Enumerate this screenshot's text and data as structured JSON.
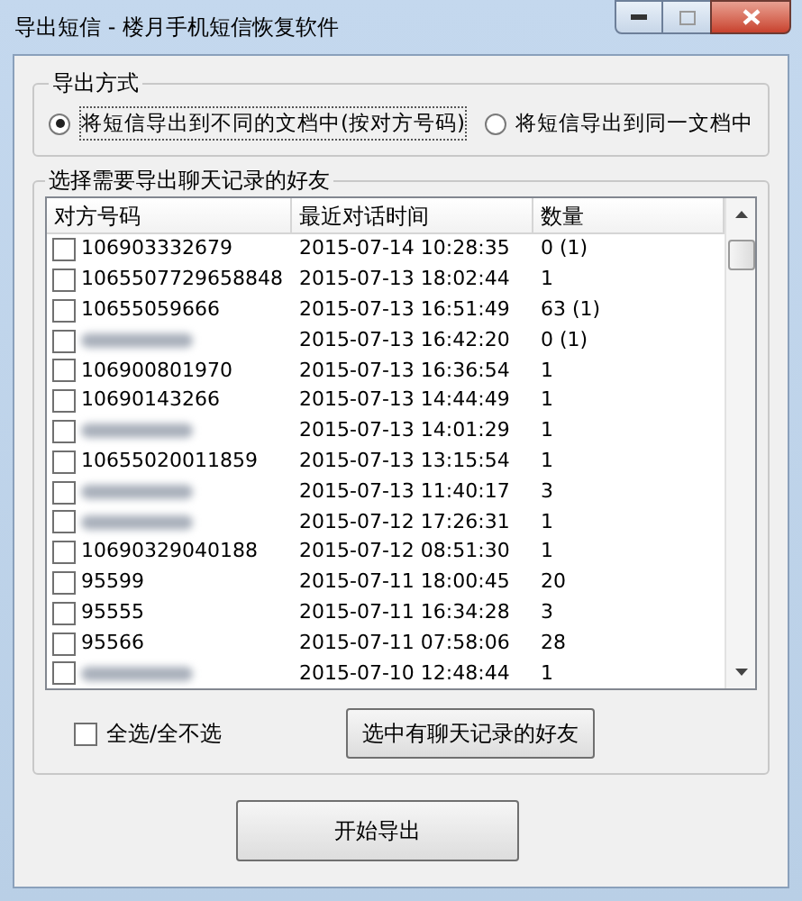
{
  "window": {
    "title": "导出短信 - 楼月手机短信恢复软件"
  },
  "export_mode": {
    "title": "导出方式",
    "options": [
      {
        "label": "将短信导出到不同的文档中(按对方号码)",
        "selected": true
      },
      {
        "label": "将短信导出到同一文档中",
        "selected": false
      }
    ]
  },
  "friends": {
    "title": "选择需要导出聊天记录的好友",
    "columns": [
      "对方号码",
      "最近对话时间",
      "数量"
    ],
    "rows": [
      {
        "number": "106903332679",
        "time": "2015-07-14 10:28:35",
        "count": "0 (1)",
        "checked": false,
        "blurred": false
      },
      {
        "number": "1065507729658848",
        "time": "2015-07-13 18:02:44",
        "count": "1",
        "checked": false,
        "blurred": false
      },
      {
        "number": "10655059666",
        "time": "2015-07-13 16:51:49",
        "count": "63 (1)",
        "checked": false,
        "blurred": false
      },
      {
        "time": "2015-07-13 16:42:20",
        "count": "0 (1)",
        "checked": false,
        "blurred": true
      },
      {
        "number": "106900801970",
        "time": "2015-07-13 16:36:54",
        "count": "1",
        "checked": false,
        "blurred": false
      },
      {
        "number": "10690143266",
        "time": "2015-07-13 14:44:49",
        "count": "1",
        "checked": false,
        "blurred": false
      },
      {
        "time": "2015-07-13 14:01:29",
        "count": "1",
        "checked": false,
        "blurred": true
      },
      {
        "number": "10655020011859",
        "time": "2015-07-13 13:15:54",
        "count": "1",
        "checked": false,
        "blurred": false
      },
      {
        "time": "2015-07-13 11:40:17",
        "count": "3",
        "checked": false,
        "blurred": true
      },
      {
        "time": "2015-07-12 17:26:31",
        "count": "1",
        "checked": false,
        "blurred": true
      },
      {
        "number": "10690329040188",
        "time": "2015-07-12 08:51:30",
        "count": "1",
        "checked": false,
        "blurred": false
      },
      {
        "number": "95599",
        "time": "2015-07-11 18:00:45",
        "count": "20",
        "checked": false,
        "blurred": false
      },
      {
        "number": "95555",
        "time": "2015-07-11 16:34:28",
        "count": "3",
        "checked": false,
        "blurred": false
      },
      {
        "number": "95566",
        "time": "2015-07-11 07:58:06",
        "count": "28",
        "checked": false,
        "blurred": false
      },
      {
        "time": "2015-07-10 12:48:44",
        "count": "1",
        "checked": false,
        "blurred": true
      }
    ],
    "select_all": {
      "label": "全选/全不选",
      "checked": false
    },
    "select_button": "选中有聊天记录的好友"
  },
  "start_button": "开始导出"
}
